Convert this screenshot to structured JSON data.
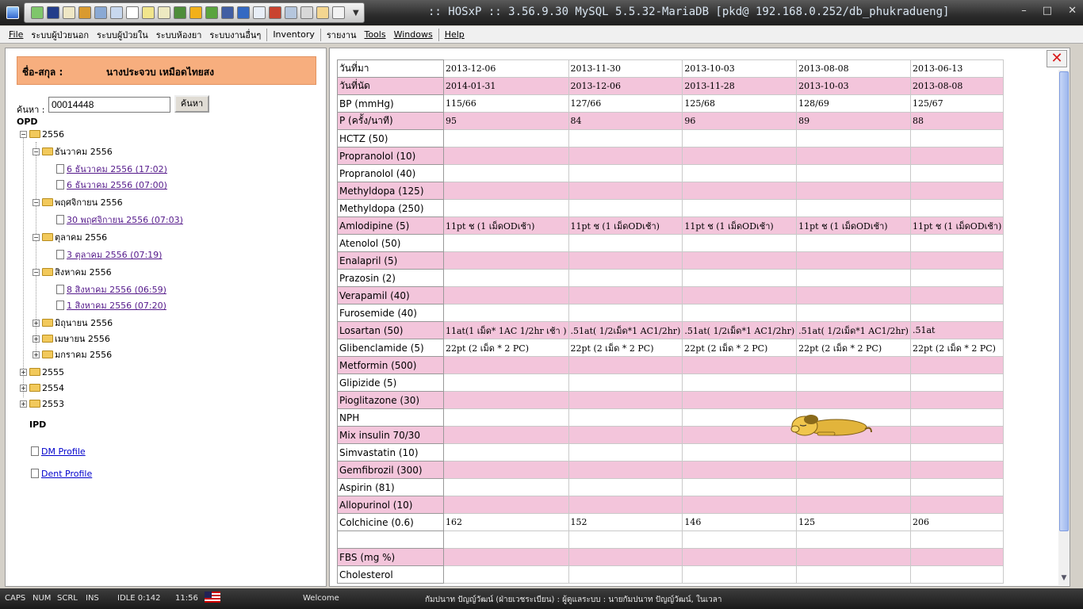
{
  "window": {
    "title": ":: HOSxP :: 3.56.9.30 MySQL 5.5.32-MariaDB [pkd@ 192.168.0.252/db_phukradueng]",
    "minimize": "–",
    "maximize": "□",
    "close": "✕"
  },
  "menu": [
    "File",
    "ระบบผู้ป่วยนอก",
    "ระบบผู้ป่วยใน",
    "ระบบห้องยา",
    "ระบบงานอื่นๆ",
    "Inventory",
    "รายงาน",
    "Tools",
    "Windows",
    "Help"
  ],
  "patient": {
    "name_label": "ชื่อ-สกุล :",
    "name_value": "นางประจวบ เหมือดไทยสง"
  },
  "search": {
    "label": "ค้นหา :",
    "value": "00014448",
    "button": "ค้นหา"
  },
  "tree": {
    "opd_label": "OPD",
    "y2556": "2556",
    "m_dec": "ธันวาคม 2556",
    "v_dec1": "6 ธันวาคม 2556 (17:02)",
    "v_dec2": "6 ธันวาคม 2556 (07:00)",
    "m_nov": "พฤศจิกายน 2556",
    "v_nov1": "30 พฤศจิกายน 2556 (07:03)",
    "m_oct": "ตุลาคม 2556",
    "v_oct1": "3 ตุลาคม 2556 (07:19)",
    "m_aug": "สิงหาคม 2556",
    "v_aug1": "8 สิงหาคม 2556 (06:59)",
    "v_aug2": "1 สิงหาคม 2556 (07:20)",
    "m_jun": "มิถุนายน 2556",
    "m_apr": "เมษายน 2556",
    "m_jan": "มกราคม 2556",
    "y2555": "2555",
    "y2554": "2554",
    "y2553": "2553",
    "ipd_label": "IPD",
    "dm_profile": "DM Profile",
    "dent_profile": "Dent Profile"
  },
  "grid": {
    "rows": [
      {
        "label": "วันที่มา",
        "style": "white",
        "cells": [
          "2013-12-06",
          "2013-11-30",
          "2013-10-03",
          "2013-08-08",
          "2013-06-13"
        ]
      },
      {
        "label": "วันที่นัด",
        "style": "pink",
        "cells": [
          "2014-01-31",
          "2013-12-06",
          "2013-11-28",
          "2013-10-03",
          "2013-08-08"
        ]
      },
      {
        "label": "BP (mmHg)",
        "style": "white",
        "cells": [
          "115/66",
          "127/66",
          "125/68",
          "128/69",
          "125/67"
        ]
      },
      {
        "label": "P (ครั้ง/นาที)",
        "style": "pink",
        "cells": [
          "95",
          "84",
          "96",
          "89",
          "88"
        ]
      },
      {
        "label": "HCTZ (50)",
        "style": "white",
        "cells": [
          "",
          "",
          "",
          "",
          ""
        ]
      },
      {
        "label": "Propranolol (10)",
        "style": "pink",
        "cells": [
          "",
          "",
          "",
          "",
          ""
        ]
      },
      {
        "label": "Propranolol (40)",
        "style": "white",
        "cells": [
          "",
          "",
          "",
          "",
          ""
        ]
      },
      {
        "label": "Methyldopa (125)",
        "style": "pink",
        "cells": [
          "",
          "",
          "",
          "",
          ""
        ]
      },
      {
        "label": "Methyldopa (250)",
        "style": "white",
        "cells": [
          "",
          "",
          "",
          "",
          ""
        ]
      },
      {
        "label": "Amlodipine (5)",
        "style": "pink",
        "cells": [
          "11pt ช (1 เม็ดODเช้า)",
          "11pt ช (1 เม็ดODเช้า)",
          "11pt ช (1 เม็ดODเช้า)",
          "11pt ช (1 เม็ดODเช้า)",
          "11pt ช (1 เม็ดODเช้า)"
        ]
      },
      {
        "label": "Atenolol (50)",
        "style": "white",
        "cells": [
          "",
          "",
          "",
          "",
          ""
        ]
      },
      {
        "label": "Enalapril (5)",
        "style": "pink",
        "cells": [
          "",
          "",
          "",
          "",
          ""
        ]
      },
      {
        "label": "Prazosin (2)",
        "style": "white",
        "cells": [
          "",
          "",
          "",
          "",
          ""
        ]
      },
      {
        "label": "Verapamil (40)",
        "style": "pink",
        "cells": [
          "",
          "",
          "",
          "",
          ""
        ]
      },
      {
        "label": "Furosemide (40)",
        "style": "white",
        "cells": [
          "",
          "",
          "",
          "",
          ""
        ]
      },
      {
        "label": "Losartan (50)",
        "style": "pink",
        "cells": [
          "11at(1 เม็ด* 1AC 1/2hr เช้า )",
          ".51at( 1/2เม็ด*1 AC1/2hr)",
          ".51at( 1/2เม็ด*1 AC1/2hr)",
          ".51at( 1/2เม็ด*1 AC1/2hr)",
          ".51at"
        ]
      },
      {
        "label": "Glibenclamide (5)",
        "style": "white",
        "cells": [
          "22pt (2 เม็ด * 2 PC)",
          "22pt (2 เม็ด * 2 PC)",
          "22pt (2 เม็ด * 2 PC)",
          "22pt (2 เม็ด * 2 PC)",
          "22pt (2 เม็ด * 2 PC)"
        ]
      },
      {
        "label": "Metformin (500)",
        "style": "pink",
        "cells": [
          "",
          "",
          "",
          "",
          ""
        ]
      },
      {
        "label": "Glipizide (5)",
        "style": "white",
        "cells": [
          "",
          "",
          "",
          "",
          ""
        ]
      },
      {
        "label": "Pioglitazone (30)",
        "style": "pink",
        "cells": [
          "",
          "",
          "",
          "",
          ""
        ]
      },
      {
        "label": "NPH",
        "style": "white",
        "cells": [
          "",
          "",
          "",
          "",
          ""
        ]
      },
      {
        "label": "Mix insulin 70/30",
        "style": "pink",
        "cells": [
          "",
          "",
          "",
          "",
          ""
        ]
      },
      {
        "label": "Simvastatin (10)",
        "style": "white",
        "cells": [
          "",
          "",
          "",
          "",
          ""
        ]
      },
      {
        "label": "Gemfibrozil (300)",
        "style": "pink",
        "cells": [
          "",
          "",
          "",
          "",
          ""
        ]
      },
      {
        "label": "Aspirin (81)",
        "style": "white",
        "cells": [
          "",
          "",
          "",
          "",
          ""
        ]
      },
      {
        "label": "Allopurinol (10)",
        "style": "pink",
        "cells": [
          "",
          "",
          "",
          "",
          ""
        ]
      },
      {
        "label": "Colchicine (0.6)",
        "style": "white",
        "cells": [
          "162",
          "152",
          "146",
          "125",
          "206"
        ]
      },
      {
        "label": "",
        "style": "white",
        "cells": [
          "",
          "",
          "",
          "",
          ""
        ]
      },
      {
        "label": "FBS (mg %)",
        "style": "pink",
        "cells": [
          "",
          "",
          "",
          "",
          ""
        ]
      },
      {
        "label": "Cholesterol",
        "style": "white",
        "cells": [
          "",
          "",
          "",
          "",
          ""
        ]
      }
    ]
  },
  "status": {
    "caps": "CAPS",
    "num": "NUM",
    "scrl": "SCRL",
    "ins": "INS",
    "idle": "IDLE 0:142",
    "time": "11:56",
    "welcome": "Welcome",
    "user_text": "กัมปนาท ปัญญ์วัฒน์ (ฝ่ายเวชระเบียน) : ผู้ดูแลระบบ : นายกัมปนาท ปัญญ์วัฒน์, ในเวลา"
  },
  "colors": {
    "pink_row": "#f3c5db",
    "patient_bar": "#f7ae7e",
    "title_bar": "#2c2c2c"
  }
}
